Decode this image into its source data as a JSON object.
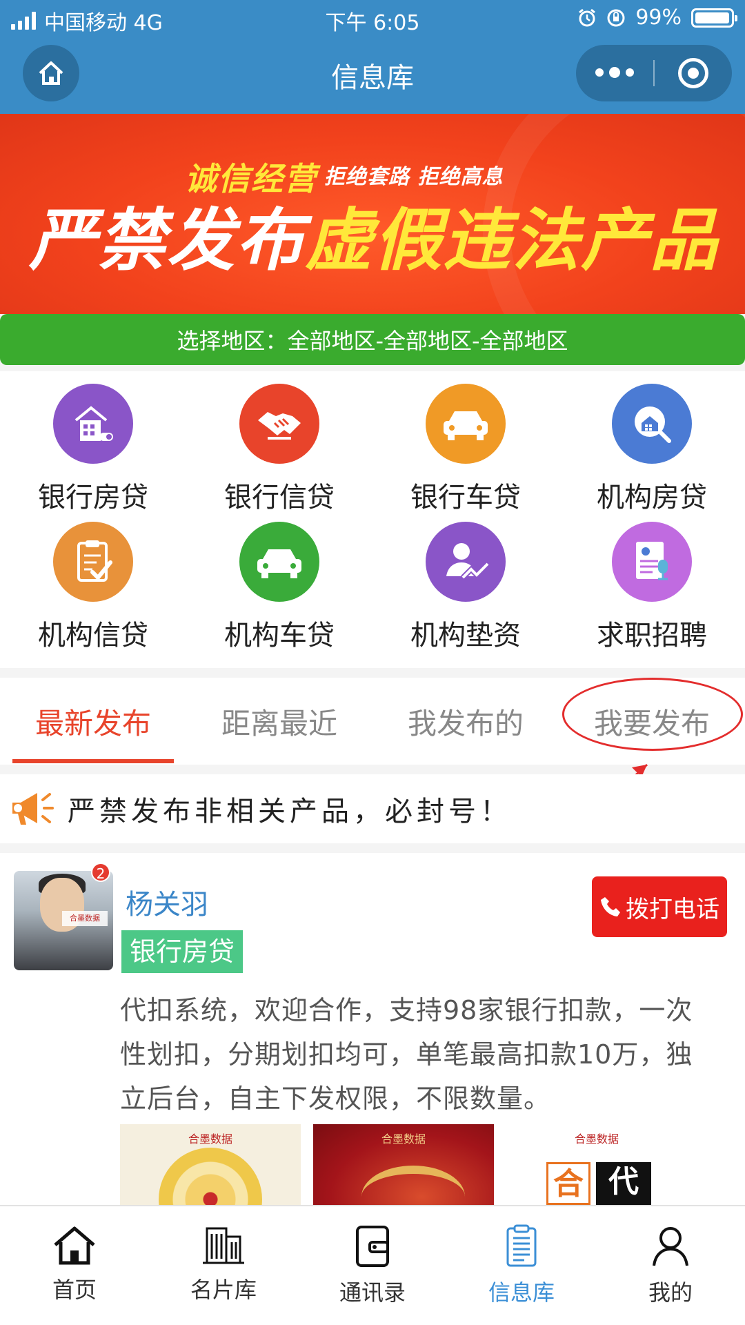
{
  "status_bar": {
    "carrier": "中国移动 4G",
    "time": "下午 6:05",
    "battery": "99%"
  },
  "nav": {
    "title": "信息库"
  },
  "banner": {
    "sub1": "诚信经营",
    "sub2": "拒绝套路 拒绝高息",
    "main_white": "严禁发布",
    "main_yellow": "虚假违法产品"
  },
  "region": {
    "label": "选择地区：全部地区-全部地区-全部地区"
  },
  "categories": [
    {
      "label": "银行房贷",
      "icon": "bank-house-icon",
      "color": "#8a55c8"
    },
    {
      "label": "银行信贷",
      "icon": "handshake-icon",
      "color": "#e8442b"
    },
    {
      "label": "银行车贷",
      "icon": "car-icon",
      "color": "#f09a26"
    },
    {
      "label": "机构房贷",
      "icon": "house-search-icon",
      "color": "#4b7bd4"
    },
    {
      "label": "机构信贷",
      "icon": "clipboard-check-icon",
      "color": "#e8923a"
    },
    {
      "label": "机构车贷",
      "icon": "car-icon",
      "color": "#3aab3a"
    },
    {
      "label": "机构垫资",
      "icon": "person-chart-icon",
      "color": "#8a55c8"
    },
    {
      "label": "求职招聘",
      "icon": "resume-icon",
      "color": "#c06be0"
    }
  ],
  "tabs": [
    {
      "label": "最新发布",
      "active": true
    },
    {
      "label": "距离最近",
      "active": false
    },
    {
      "label": "我发布的",
      "active": false
    },
    {
      "label": "我要发布",
      "active": false
    }
  ],
  "notice": {
    "text": "严禁发布非相关产品，必封号！"
  },
  "post": {
    "name": "杨关羽",
    "badge": "2",
    "tag": "银行房贷",
    "call_label": "拨打电话",
    "description": "代扣系统，欢迎合作，支持98家银行扣款，一次性划扣，分期划扣均可，单笔最高扣款10万，独立后台，自主下发权限，不限数量。",
    "avatar_brand": "合墨数据",
    "thumb1_logo": "合墨数据",
    "thumb2_logo": "合墨数据",
    "thumb3_logo": "合墨数据",
    "thumb3_box1": "合",
    "thumb3_box2": "代"
  },
  "bottom_nav": [
    {
      "label": "首页",
      "icon": "home-icon",
      "active": false
    },
    {
      "label": "名片库",
      "icon": "building-icon",
      "active": false
    },
    {
      "label": "通讯录",
      "icon": "wallet-icon",
      "active": false
    },
    {
      "label": "信息库",
      "icon": "clipboard-list-icon",
      "active": true
    },
    {
      "label": "我的",
      "icon": "user-icon",
      "active": false
    }
  ],
  "colors": {
    "header": "#3a8cc6",
    "accent_red": "#e8442b",
    "region_green": "#3aab2e",
    "active_blue": "#3b8fd6"
  }
}
